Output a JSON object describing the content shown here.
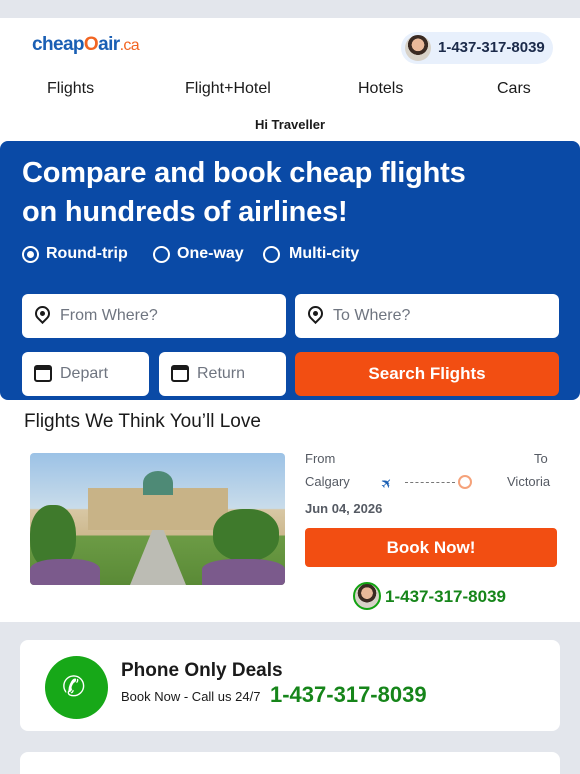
{
  "header": {
    "logo": {
      "cheap": "cheap",
      "o": "O",
      "air": "air",
      "ca": ".ca"
    },
    "phone": "1-437-317-8039"
  },
  "nav": [
    "Flights",
    "Flight+Hotel",
    "Hotels",
    "Cars"
  ],
  "greeting": "Hi Traveller",
  "hero": {
    "title_line1": "Compare and book cheap flights",
    "title_line2": "on hundreds of airlines!",
    "trip_types": [
      "Round-trip",
      "One-way",
      "Multi-city"
    ],
    "selected_trip": "Round-trip",
    "from_placeholder": "From Where?",
    "to_placeholder": "To Where?",
    "depart_placeholder": "Depart",
    "return_placeholder": "Return",
    "search_label": "Search Flights"
  },
  "deals": {
    "title": "Flights We Think You’ll Love",
    "from_label": "From",
    "to_label": "To",
    "origin": "Calgary",
    "destination": "Victoria",
    "date": "Jun 04, 2026",
    "book_label": "Book Now!",
    "phone": "1-437-317-8039"
  },
  "phone_deals": {
    "title": "Phone Only Deals",
    "subtitle": "Book Now - Call us 24/7",
    "phone": "1-437-317-8039"
  },
  "colors": {
    "brand_blue": "#0a4aa6",
    "cta_orange": "#f24e12",
    "phone_green": "#16851a"
  }
}
